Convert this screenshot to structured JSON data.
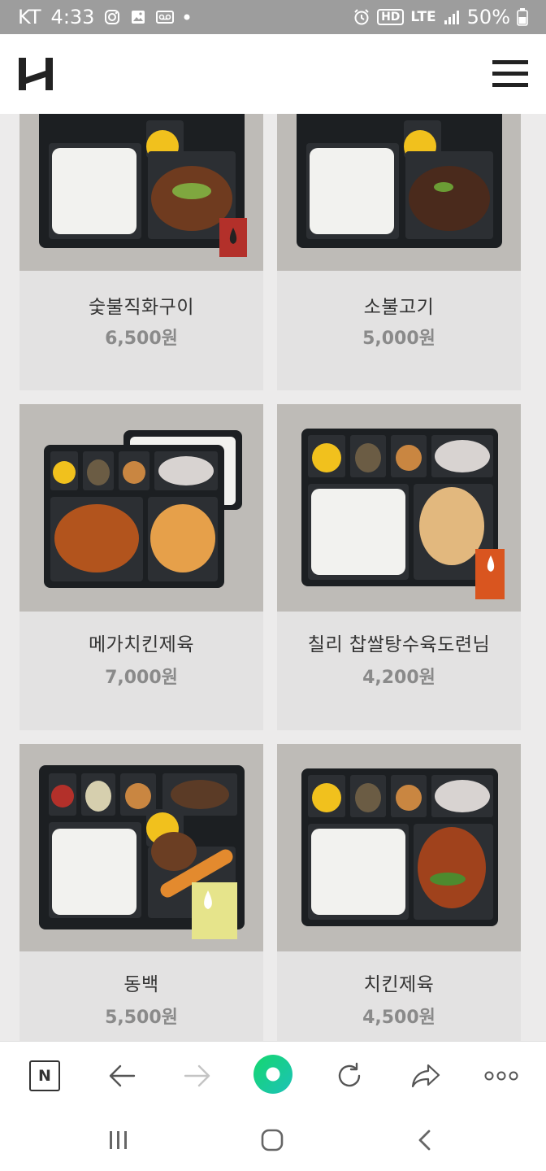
{
  "status_bar": {
    "carrier": "KT",
    "time": "4:33",
    "network": "LTE",
    "battery": "50%",
    "hd_label": "HD"
  },
  "header": {
    "logo_icon": "h-logo",
    "menu_icon": "hamburger-icon"
  },
  "products": [
    {
      "name": "숯불직화구이",
      "price": "6,500원"
    },
    {
      "name": "소불고기",
      "price": "5,000원"
    },
    {
      "name": "메가치킨제육",
      "price": "7,000원"
    },
    {
      "name": "칠리 찹쌀탕수육도련님",
      "price": "4,200원"
    },
    {
      "name": "동백",
      "price": "5,500원"
    },
    {
      "name": "치킨제육",
      "price": "4,500원"
    }
  ],
  "browser_bar": {
    "n_label": "N",
    "items": [
      "naver-home-icon",
      "back-arrow-icon",
      "forward-arrow-icon",
      "green-home-icon",
      "refresh-icon",
      "share-icon",
      "more-icon"
    ]
  },
  "colors": {
    "status_bar": "#9d9d9d",
    "card_image_bg": "#bebbb7",
    "card_bg": "#e3e2e2",
    "accent_green": "#1ec87a"
  }
}
